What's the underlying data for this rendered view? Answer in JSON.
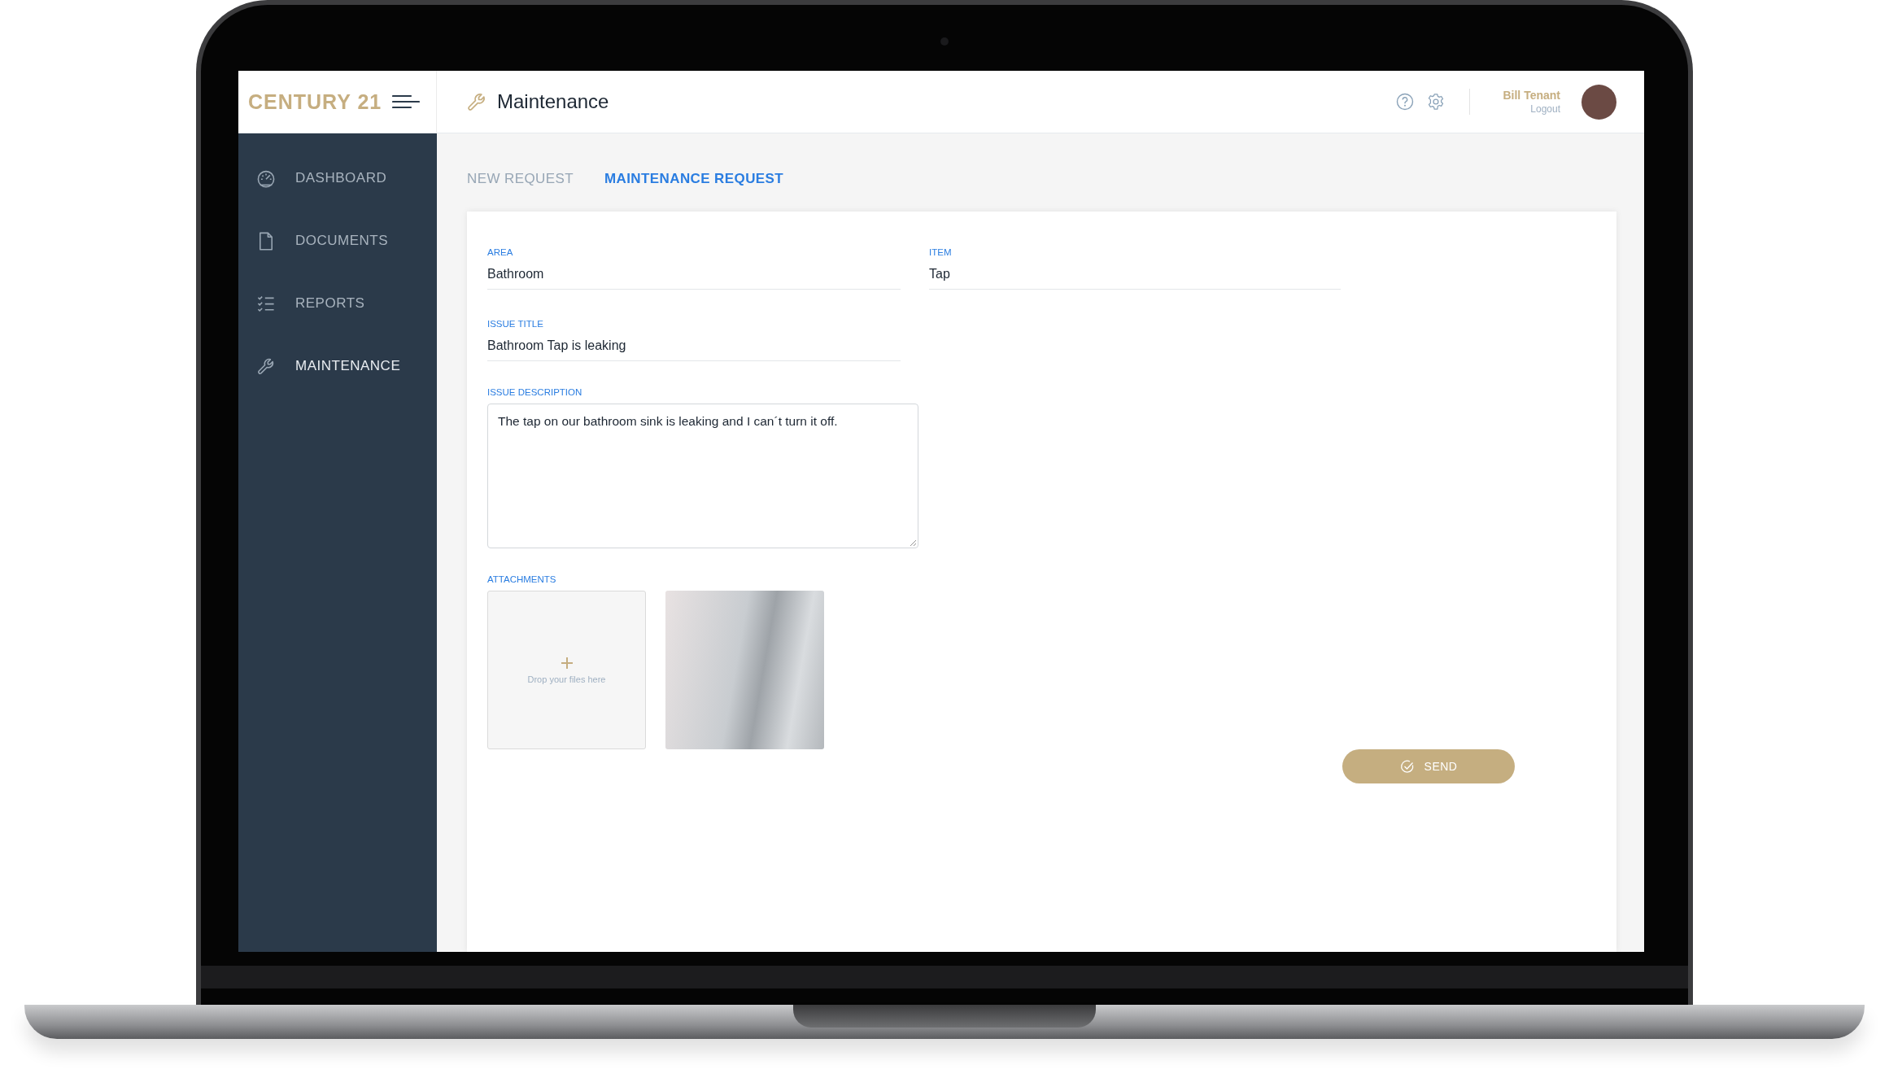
{
  "header": {
    "logo": "CENTURY 21",
    "page_title": "Maintenance",
    "user": {
      "name": "Bill Tenant",
      "logout": "Logout"
    }
  },
  "sidebar": {
    "items": [
      {
        "label": "DASHBOARD",
        "kind": "dashboard",
        "selected": false
      },
      {
        "label": "DOCUMENTS",
        "kind": "documents",
        "selected": false
      },
      {
        "label": "REPORTS",
        "kind": "reports",
        "selected": false
      },
      {
        "label": "MAINTENANCE",
        "kind": "maintenance",
        "selected": true
      }
    ]
  },
  "tabs": [
    {
      "label": "NEW REQUEST",
      "selected": false
    },
    {
      "label": "MAINTENANCE REQUEST",
      "selected": true
    }
  ],
  "form": {
    "fields": [
      {
        "label": "AREA",
        "value": "Bathroom"
      },
      {
        "label": "ITEM",
        "value": "Tap"
      },
      {
        "label": "ISSUE TITLE",
        "value": "Bathroom Tap is leaking"
      }
    ],
    "description": {
      "label": "ISSUE DESCRIPTION",
      "value": "The tap on our bathroom sink is leaking and I can´t turn it off."
    },
    "attachments": {
      "label": "ATTACHMENTS",
      "dropzone": "Drop your files here",
      "files": [
        {
          "kind": "photo"
        }
      ]
    },
    "send_button": "SEND"
  }
}
